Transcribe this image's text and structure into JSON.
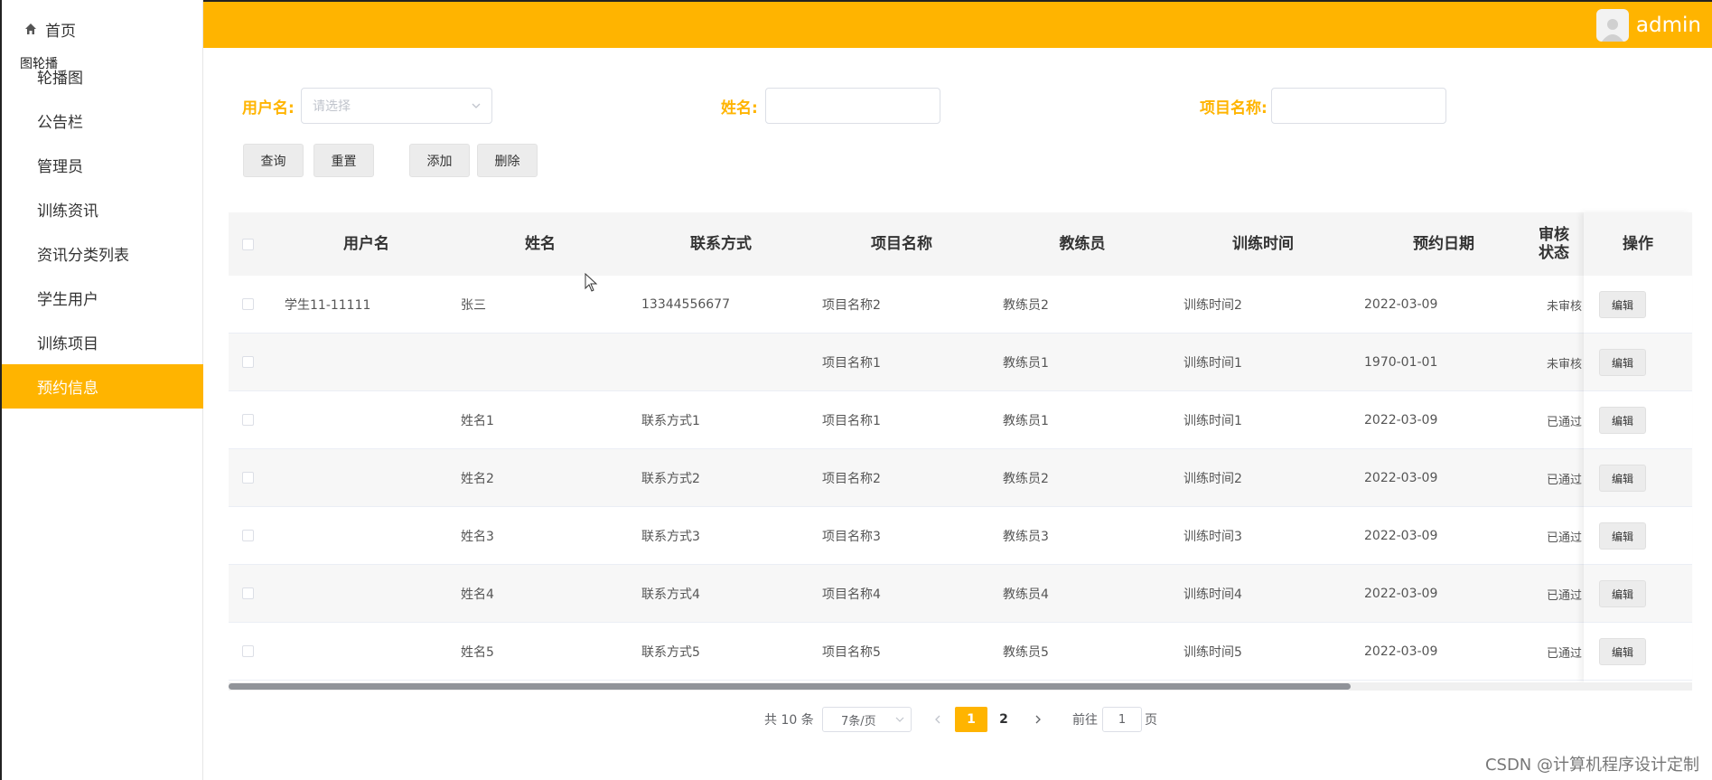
{
  "sidebar": {
    "home_label": "首页",
    "overlap_text": "图轮播",
    "items": [
      {
        "label": "轮播图"
      },
      {
        "label": "公告栏"
      },
      {
        "label": "管理员"
      },
      {
        "label": "训练资讯"
      },
      {
        "label": "资讯分类列表"
      },
      {
        "label": "学生用户"
      },
      {
        "label": "训练项目"
      },
      {
        "label": "预约信息",
        "active": true
      }
    ]
  },
  "header": {
    "username": "admin"
  },
  "filters": {
    "username_label": "用户名:",
    "username_placeholder": "请选择",
    "name_label": "姓名:",
    "project_label": "项目名称:"
  },
  "buttons": {
    "search": "查询",
    "reset": "重置",
    "add": "添加",
    "delete": "删除"
  },
  "table": {
    "headers": [
      "用户名",
      "姓名",
      "联系方式",
      "项目名称",
      "教练员",
      "训练时间",
      "预约日期",
      "审核状态",
      "操作"
    ],
    "edit_label": "编辑",
    "rows": [
      [
        "学生11-11111",
        "张三",
        "13344556677",
        "项目名称2",
        "教练员2",
        "训练时间2",
        "2022-03-09",
        "未审核"
      ],
      [
        "",
        "",
        "",
        "项目名称1",
        "教练员1",
        "训练时间1",
        "1970-01-01",
        "未审核"
      ],
      [
        "",
        "姓名1",
        "联系方式1",
        "项目名称1",
        "教练员1",
        "训练时间1",
        "2022-03-09",
        "已通过"
      ],
      [
        "",
        "姓名2",
        "联系方式2",
        "项目名称2",
        "教练员2",
        "训练时间2",
        "2022-03-09",
        "已通过"
      ],
      [
        "",
        "姓名3",
        "联系方式3",
        "项目名称3",
        "教练员3",
        "训练时间3",
        "2022-03-09",
        "已通过"
      ],
      [
        "",
        "姓名4",
        "联系方式4",
        "项目名称4",
        "教练员4",
        "训练时间4",
        "2022-03-09",
        "已通过"
      ],
      [
        "",
        "姓名5",
        "联系方式5",
        "项目名称5",
        "教练员5",
        "训练时间5",
        "2022-03-09",
        "已通过"
      ]
    ]
  },
  "pagination": {
    "total_text": "共 10 条",
    "page_size": "7条/页",
    "pages": [
      "1",
      "2"
    ],
    "current_page": "1",
    "goto_prefix": "前往",
    "goto_value": "1",
    "goto_suffix": "页"
  },
  "watermark": "CSDN @计算机程序设计定制",
  "colors": {
    "accent": "#ffb400"
  }
}
